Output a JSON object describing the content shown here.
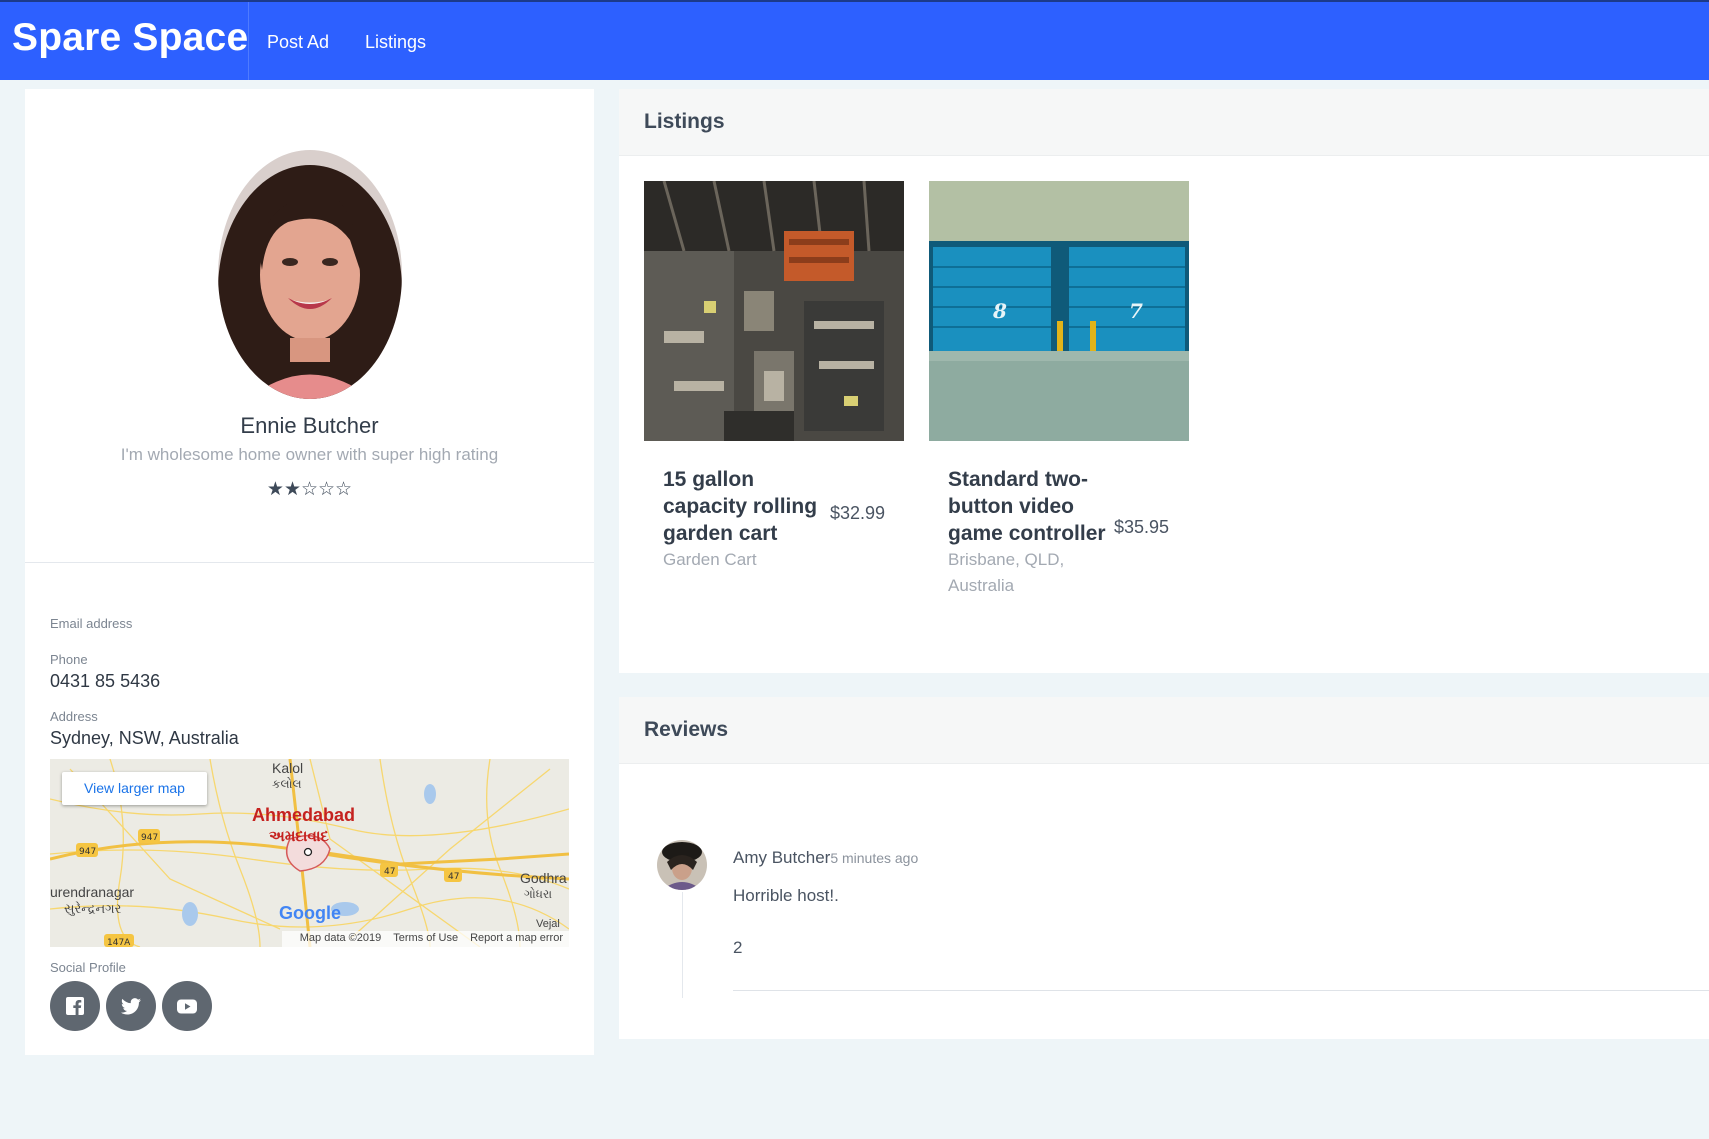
{
  "nav": {
    "brand": "Spare Space",
    "links": [
      "Post Ad",
      "Listings"
    ]
  },
  "profile": {
    "name": "Ennie Butcher",
    "bio": "I'm wholesome home owner with super high rating",
    "rating": 2,
    "rating_max": 5,
    "rating_stars": "★★☆☆☆",
    "email_label": "Email address",
    "email_value": "",
    "phone_label": "Phone",
    "phone_value": "0431 85 5436",
    "address_label": "Address",
    "address_value": "Sydney, NSW, Australia",
    "social_label": "Social Profile",
    "socials": [
      "facebook-icon",
      "twitter-icon",
      "youtube-icon"
    ]
  },
  "map": {
    "button": "View larger map",
    "labels": {
      "kalol": "Kalol",
      "kalol_guj": "કલોલ",
      "ahmedabad": "Ahmedabad",
      "ahmedabad_guj": "અમદાવાદ",
      "surendranagar": "urendranagar",
      "surendranagar_guj": "સુરેન્દ્રનગર",
      "godhra": "Godhra",
      "godhra_guj": "ગોધરા",
      "vejal": "Vejal",
      "r947a": "947",
      "r947b": "947",
      "r47a": "47",
      "r47b": "47",
      "r147a": "147A"
    },
    "google": "Google",
    "footer": {
      "data": "Map data ©2019",
      "terms": "Terms of Use",
      "report": "Report a map error"
    }
  },
  "listings": {
    "title": "Listings",
    "items": [
      {
        "title": "15 gallon capacity rolling garden cart",
        "price": "$32.99",
        "subtitle": "Garden Cart"
      },
      {
        "title": "Standard two-button video game controller",
        "price": "$35.95",
        "subtitle": "Brisbane, QLD, Australia",
        "door_a": "8",
        "door_b": "7"
      }
    ]
  },
  "reviews": {
    "title": "Reviews",
    "items": [
      {
        "author": "Amy Butcher",
        "time": "5 minutes ago",
        "text": "Horrible host!.",
        "number": "2"
      }
    ]
  },
  "colors": {
    "navbar": "#2d60ff",
    "background": "#eef5f8",
    "social": "#5f6770"
  }
}
